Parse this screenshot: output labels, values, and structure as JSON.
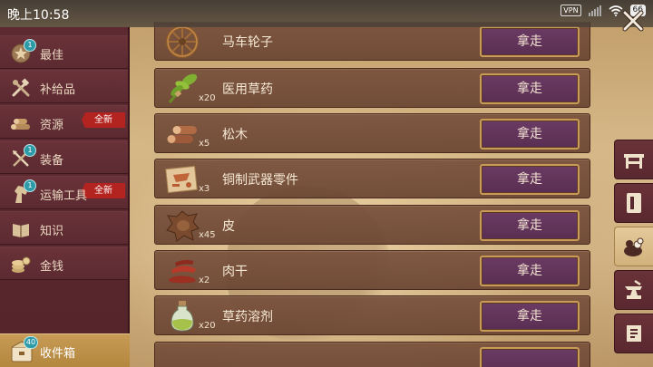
{
  "status_bar": {
    "time": "晚上10:58",
    "vpn": "VPN",
    "battery": "66"
  },
  "sidebar": {
    "items": [
      {
        "label": "最佳",
        "icon": "star-badge-icon",
        "badge": "1",
        "ribbon": ""
      },
      {
        "label": "补给品",
        "icon": "crossed-tools-icon",
        "badge": "",
        "ribbon": ""
      },
      {
        "label": "资源",
        "icon": "log-pile-icon",
        "badge": "",
        "ribbon": "全新"
      },
      {
        "label": "装备",
        "icon": "crossed-weapons-icon",
        "badge": "1",
        "ribbon": ""
      },
      {
        "label": "运输工具",
        "icon": "horse-head-icon",
        "badge": "1",
        "ribbon": "全新"
      },
      {
        "label": "知识",
        "icon": "book-icon",
        "badge": "",
        "ribbon": ""
      },
      {
        "label": "金钱",
        "icon": "coins-icon",
        "badge": "",
        "ribbon": ""
      }
    ],
    "bottom": {
      "label": "收件箱",
      "badge": "40",
      "icon": "inbox-icon"
    }
  },
  "items": [
    {
      "name": "马车轮子",
      "qty": "",
      "icon": "wagon-wheel-icon",
      "button": "拿走"
    },
    {
      "name": "医用草药",
      "qty": "x20",
      "icon": "herb-icon",
      "button": "拿走"
    },
    {
      "name": "松木",
      "qty": "x5",
      "icon": "pine-wood-icon",
      "button": "拿走"
    },
    {
      "name": "铜制武器零件",
      "qty": "x3",
      "icon": "copper-parts-icon",
      "button": "拿走"
    },
    {
      "name": "皮",
      "qty": "x45",
      "icon": "hide-icon",
      "button": "拿走"
    },
    {
      "name": "肉干",
      "qty": "x2",
      "icon": "jerky-icon",
      "button": "拿走"
    },
    {
      "name": "草药溶剂",
      "qty": "x20",
      "icon": "potion-bottle-icon",
      "button": "拿走"
    }
  ],
  "right_tabs": [
    {
      "icon": "workbench-icon",
      "active": false
    },
    {
      "icon": "scroll-icon",
      "active": false
    },
    {
      "icon": "resource-bag-icon",
      "active": true
    },
    {
      "icon": "anvil-icon",
      "active": false
    },
    {
      "icon": "map-icon",
      "active": false
    }
  ],
  "colors": {
    "sidebar": "#5d2a31",
    "row": "#74503a",
    "button": "#5e3157",
    "button_border": "#c99a58",
    "badge": "#2d9aa8",
    "ribbon": "#b3231f"
  }
}
